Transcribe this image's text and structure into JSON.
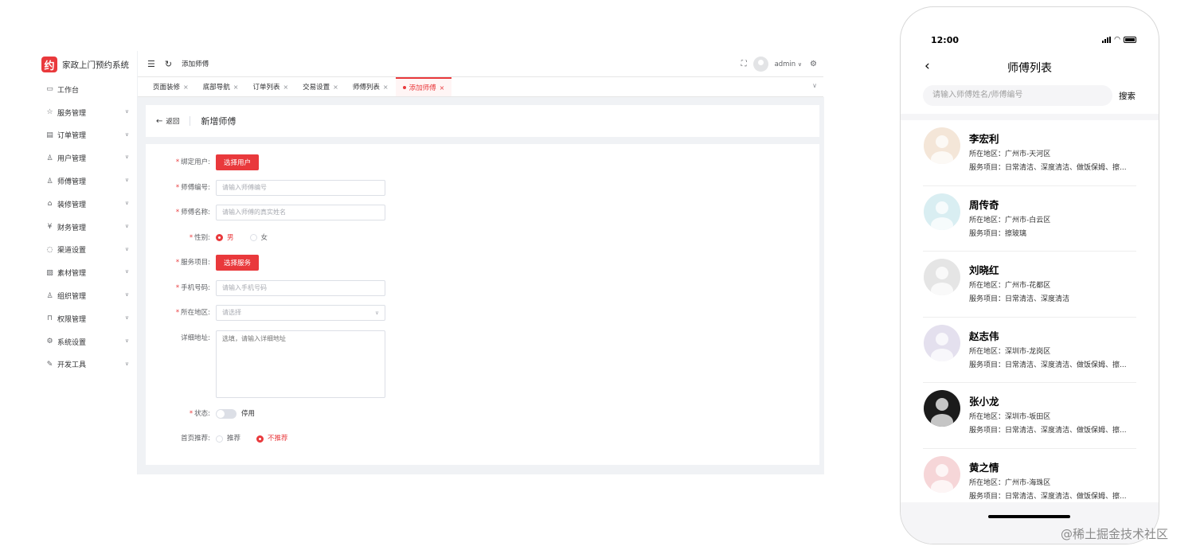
{
  "admin": {
    "app_title": "家政上门预约系统",
    "logo_glyph": "约",
    "accent_color": "#e9393c",
    "sidebar": {
      "items": [
        {
          "label": "工作台",
          "icon": "monitor-icon",
          "glyph": "▭"
        },
        {
          "label": "服务管理",
          "icon": "star-icon",
          "glyph": "☆"
        },
        {
          "label": "订单管理",
          "icon": "document-icon",
          "glyph": "▤"
        },
        {
          "label": "用户管理",
          "icon": "user-icon",
          "glyph": "♙"
        },
        {
          "label": "师傅管理",
          "icon": "worker-icon",
          "glyph": "♙"
        },
        {
          "label": "装修管理",
          "icon": "shop-icon",
          "glyph": "⌂"
        },
        {
          "label": "财务管理",
          "icon": "yen-icon",
          "glyph": "¥"
        },
        {
          "label": "渠道设置",
          "icon": "chat-icon",
          "glyph": "◌"
        },
        {
          "label": "素材管理",
          "icon": "picture-icon",
          "glyph": "▨"
        },
        {
          "label": "组织管理",
          "icon": "user-icon",
          "glyph": "♙"
        },
        {
          "label": "权限管理",
          "icon": "lock-icon",
          "glyph": "⊓"
        },
        {
          "label": "系统设置",
          "icon": "gear-icon",
          "glyph": "⚙"
        },
        {
          "label": "开发工具",
          "icon": "pen-icon",
          "glyph": "✎"
        }
      ]
    },
    "header": {
      "breadcrumb": "添加师傅",
      "user_name": "admin"
    },
    "tabs": [
      {
        "label": "页面装修"
      },
      {
        "label": "底部导航"
      },
      {
        "label": "订单列表"
      },
      {
        "label": "交易设置"
      },
      {
        "label": "师傅列表"
      },
      {
        "label": "添加师傅",
        "active": true
      }
    ],
    "page": {
      "back_label": "返回",
      "title": "新增师傅"
    },
    "form": {
      "bind_user": {
        "label": "绑定用户:",
        "button": "选择用户"
      },
      "worker_no": {
        "label": "师傅编号:",
        "placeholder": "请输入师傅编号"
      },
      "worker_name": {
        "label": "师傅名称:",
        "placeholder": "请输入师傅的真实姓名"
      },
      "gender": {
        "label": "性别:",
        "options": [
          "男",
          "女"
        ],
        "selected": "男"
      },
      "service": {
        "label": "服务项目:",
        "button": "选择服务"
      },
      "phone": {
        "label": "手机号码:",
        "placeholder": "请输入手机号码"
      },
      "region": {
        "label": "所在地区:",
        "placeholder": "请选择"
      },
      "address": {
        "label": "详细地址:",
        "placeholder": "选填，请输入详细地址"
      },
      "status": {
        "label": "状态:",
        "value": "停用"
      },
      "recommend": {
        "label": "首页推荐:",
        "options": [
          "推荐",
          "不推荐"
        ],
        "selected": "不推荐"
      }
    }
  },
  "mobile": {
    "time": "12:00",
    "title": "师傅列表",
    "search_placeholder": "请输入师傅姓名/师傅编号",
    "search_button": "搜索",
    "workers": [
      {
        "name": "李宏利",
        "area": "所在地区：广州市-天河区",
        "services": "服务项目：日常清洁、深度清洁、做饭保姆、擦...",
        "avatar_color": "#f4e6d8"
      },
      {
        "name": "周传奇",
        "area": "所在地区：广州市-白云区",
        "services": "服务项目：擦玻璃",
        "avatar_color": "#d9eef2"
      },
      {
        "name": "刘晓红",
        "area": "所在地区：广州市-花都区",
        "services": "服务项目：日常清洁、深度清洁",
        "avatar_color": "#e5e5e5"
      },
      {
        "name": "赵志伟",
        "area": "所在地区：深圳市-龙岗区",
        "services": "服务项目：日常清洁、深度清洁、做饭保姆、擦...",
        "avatar_color": "#e4e0ee"
      },
      {
        "name": "张小龙",
        "area": "所在地区：深圳市-坂田区",
        "services": "服务项目：日常清洁、深度清洁、做饭保姆、擦...",
        "avatar_color": "#1b1b1b"
      },
      {
        "name": "黄之情",
        "area": "所在地区：广州市-海珠区",
        "services": "服务项目：日常清洁、深度清洁、做饭保姆、擦...",
        "avatar_color": "#f6d6d8"
      }
    ]
  },
  "watermark": "@稀土掘金技术社区"
}
